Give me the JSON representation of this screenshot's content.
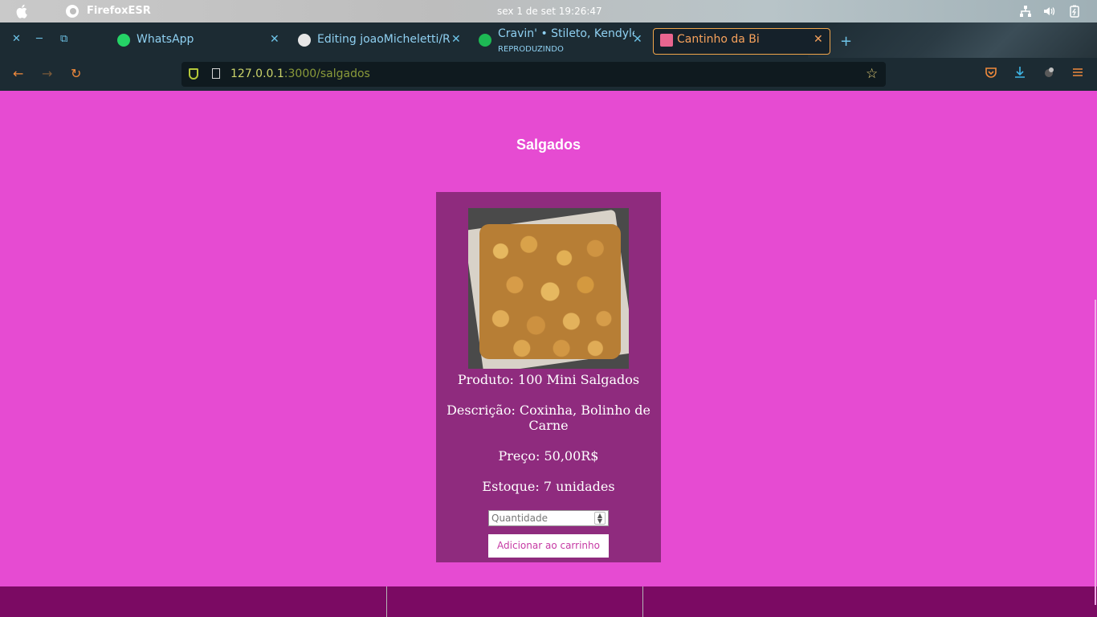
{
  "os": {
    "app_name": "FirefoxESR",
    "clock": "sex 1 de set  19:26:47"
  },
  "browser": {
    "tabs": [
      {
        "label": "WhatsApp",
        "icon": "whatsapp-icon",
        "active": false
      },
      {
        "label": "Editing joaoMicheletti/RE",
        "icon": "github-icon",
        "active": false
      },
      {
        "label": "Cravin' • Stileto, Kendyle P",
        "sub": "REPRODUZINDO",
        "icon": "spotify-icon",
        "active": false
      },
      {
        "label": "Cantinho da Bi",
        "icon": "site-favicon",
        "active": true
      }
    ],
    "url_host": "127.0.0.1",
    "url_rest": ":3000/salgados"
  },
  "page": {
    "title": "Salgados",
    "product": {
      "name": "Produto: 100 Mini Salgados",
      "description": "Descrição: Coxinha, Bolinho de Carne",
      "price": "Preço: 50,00R$",
      "stock": "Estoque: 7 unidades",
      "quantity_placeholder": "Quantidade",
      "add_button": "Adicionar ao carrinho"
    }
  },
  "colors": {
    "page_bg": "#e64bd2",
    "card_bg": "#8f2b7e",
    "footer_bg": "#7b0a63",
    "accent": "#f0a54b"
  }
}
